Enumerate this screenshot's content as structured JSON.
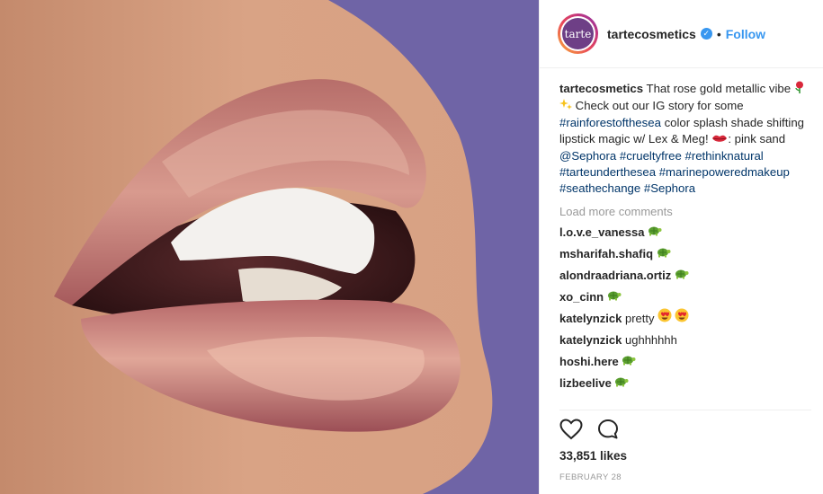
{
  "post": {
    "image_alt": "Close-up of lips wearing rose gold metallic lipstick"
  },
  "header": {
    "avatar_text": "tarte",
    "username": "tartecosmetics",
    "separator": "•",
    "follow_label": "Follow"
  },
  "caption": {
    "username": "tartecosmetics",
    "text_1": "That rose gold metallic vibe",
    "text_2": "Check out our IG story for some",
    "tag_1": "#rainforestofthesea",
    "text_3": "color splash shade shifting lipstick magic w/ Lex & Meg!",
    "text_4": ": pink sand",
    "mention": "@Sephora",
    "tag_2": "#crueltyfree",
    "tag_3": "#rethinknatural",
    "tag_4": "#tarteunderthesea",
    "tag_5": "#marinepoweredmakeup",
    "tag_6": "#seathechange",
    "tag_7": "#Sephora"
  },
  "load_more": "Load more comments",
  "comments": [
    {
      "user": "l.o.v.e_vanessa",
      "text": ""
    },
    {
      "user": "msharifah.shafiq",
      "text": ""
    },
    {
      "user": "alondraadriana.ortiz",
      "text": ""
    },
    {
      "user": "xo_cinn",
      "text": ""
    },
    {
      "user": "katelynzick",
      "text": "pretty"
    },
    {
      "user": "katelynzick",
      "text": "ughhhhhh"
    },
    {
      "user": "hoshi.here",
      "text": ""
    },
    {
      "user": "lizbeelive",
      "text": ""
    }
  ],
  "likes": "33,851 likes",
  "date": "FEBRUARY 28",
  "colors": {
    "accent": "#3897f0",
    "tag": "#003569",
    "background_purple": "#6f64a6"
  }
}
